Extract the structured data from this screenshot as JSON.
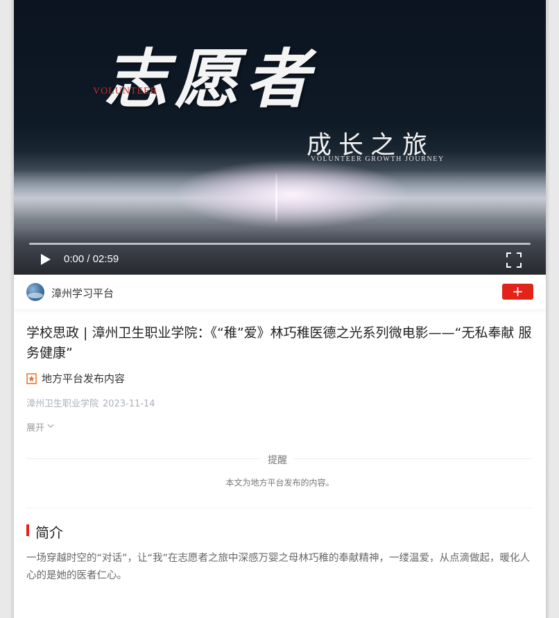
{
  "video": {
    "title_main": "志愿者",
    "title_en": "VOLUNTEER",
    "subtitle": "成长之旅",
    "subtitle_en": "VOLUNTEER GROWTH JOURNEY",
    "time": "0:00 / 02:59",
    "progress": 0
  },
  "channel": {
    "name": "漳州学习平台",
    "follow_label": "+"
  },
  "article": {
    "title": "学校思政 | 漳州卫生职业学院：《“稚”爱》林巧稚医德之光系列微电影——“无私奉献 服务健康”",
    "source_tag": "地方平台发布内容",
    "author": "漳州卫生职业学院",
    "date": "2023-11-14",
    "expand_label": "展开"
  },
  "reminder": {
    "title": "提醒",
    "text": "本文为地方平台发布的内容。"
  },
  "intro": {
    "heading": "简介",
    "text": "一场穿越时空的“对话”，让“我”在志愿者之旅中深感万婴之母林巧稚的奉献精神，一缕温爱，从点滴做起，暖化人心的是她的医者仁心。"
  },
  "colors": {
    "accent": "#e2231a"
  }
}
